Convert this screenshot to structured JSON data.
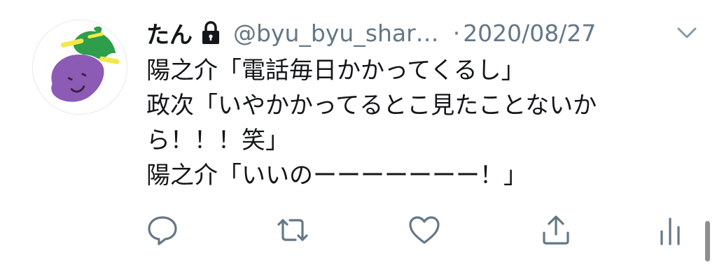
{
  "tweet": {
    "display_name": "たん",
    "handle": "@byu_byu_shar…",
    "separator": "·",
    "date": "2020/08/27",
    "lines": [
      "陽之介「電話毎日かかってくるし」",
      "政次「いやかかってるとこ見たことないか",
      "ら！！！笑」",
      "陽之介「いいのーーーーーーー！」"
    ]
  },
  "icons": {
    "avatar": "eggplant-avatar",
    "lock": "lock-icon",
    "caret": "chevron-down-icon",
    "reply": "reply-icon",
    "retweet": "retweet-icon",
    "like": "heart-icon",
    "share": "share-icon",
    "stats": "analytics-icon"
  },
  "colors": {
    "text": "#14171a",
    "secondary": "#657786",
    "eggplant": "#8c5bb5",
    "leaf": "#2e9e4a",
    "accent_yellow": "#f2e84b"
  }
}
